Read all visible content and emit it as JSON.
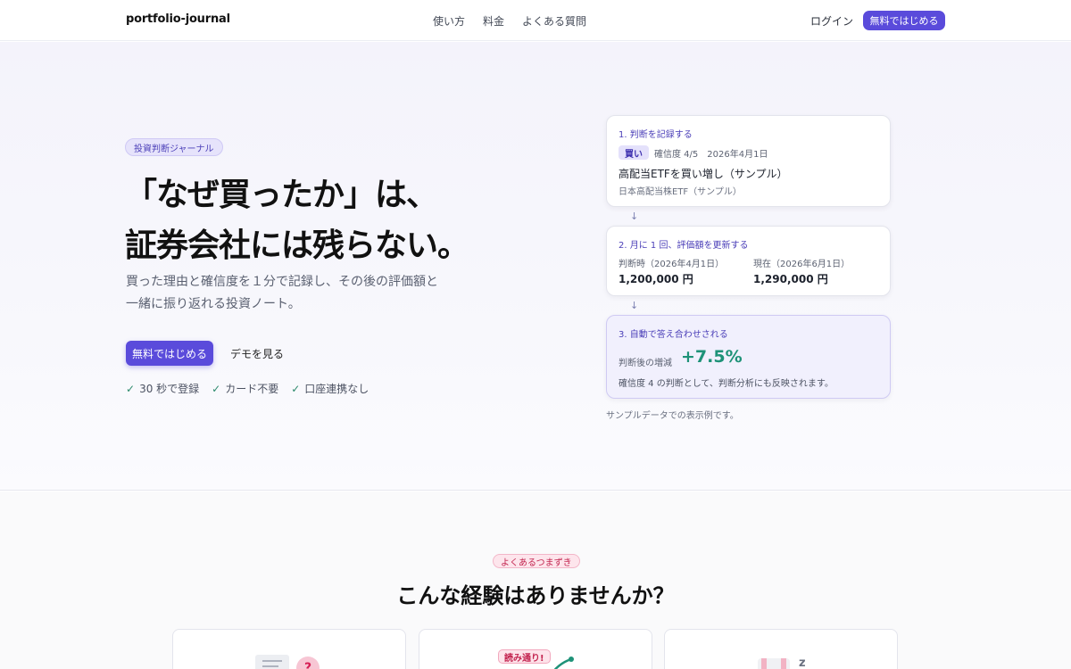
{
  "header": {
    "logo": "portfolio-journal",
    "nav": [
      "使い方",
      "料金",
      "よくある質問"
    ],
    "login": "ログイン",
    "cta": "無料ではじめる"
  },
  "hero": {
    "pill": "投資判断ジャーナル",
    "title_line1": "「なぜ買ったか」は、",
    "title_line2": "証券会社には残らない。",
    "lead_line1": "買った理由と確信度を１分で記録し、その後の評価額と",
    "lead_line2": "一緒に振り返れる投資ノート。",
    "primary_button": "無料ではじめる",
    "demo_button": "デモを見る",
    "checks": [
      "30 秒で登録",
      "カード不要",
      "口座連携なし"
    ]
  },
  "steps": {
    "step1": {
      "title": "1. 判断を記録する",
      "tag": "買い",
      "meta": "確信度 4/5　2026年4月1日",
      "trade_title": "高配当ETFを買い増し（サンプル）",
      "trade_sub": "日本高配当株ETF（サンプル）"
    },
    "arrow": "↓",
    "step2": {
      "title": "2. 月に 1 回、評価額を更新する",
      "left_label": "判断時（2026年4月1日）",
      "left_value": "1,200,000 円",
      "right_label": "現在（2026年6月1日）",
      "right_value": "1,290,000 円"
    },
    "step3": {
      "title": "3. 自動で答え合わせされる",
      "label": "判断後の増減",
      "value": "+7.5%",
      "note": "確信度 4 の判断として、判断分析にも反映されます。"
    },
    "sample_note": "サンプルデータでの表示例です。"
  },
  "problems": {
    "pill": "よくあるつまずき",
    "title": "こんな経験はありませんか？",
    "card2_badge": "読み通り!",
    "card1_question": "?",
    "card3_z": "z"
  },
  "colors": {
    "accent": "#5a4bdb",
    "positive": "#1e9278",
    "pink": "#c2244f"
  }
}
